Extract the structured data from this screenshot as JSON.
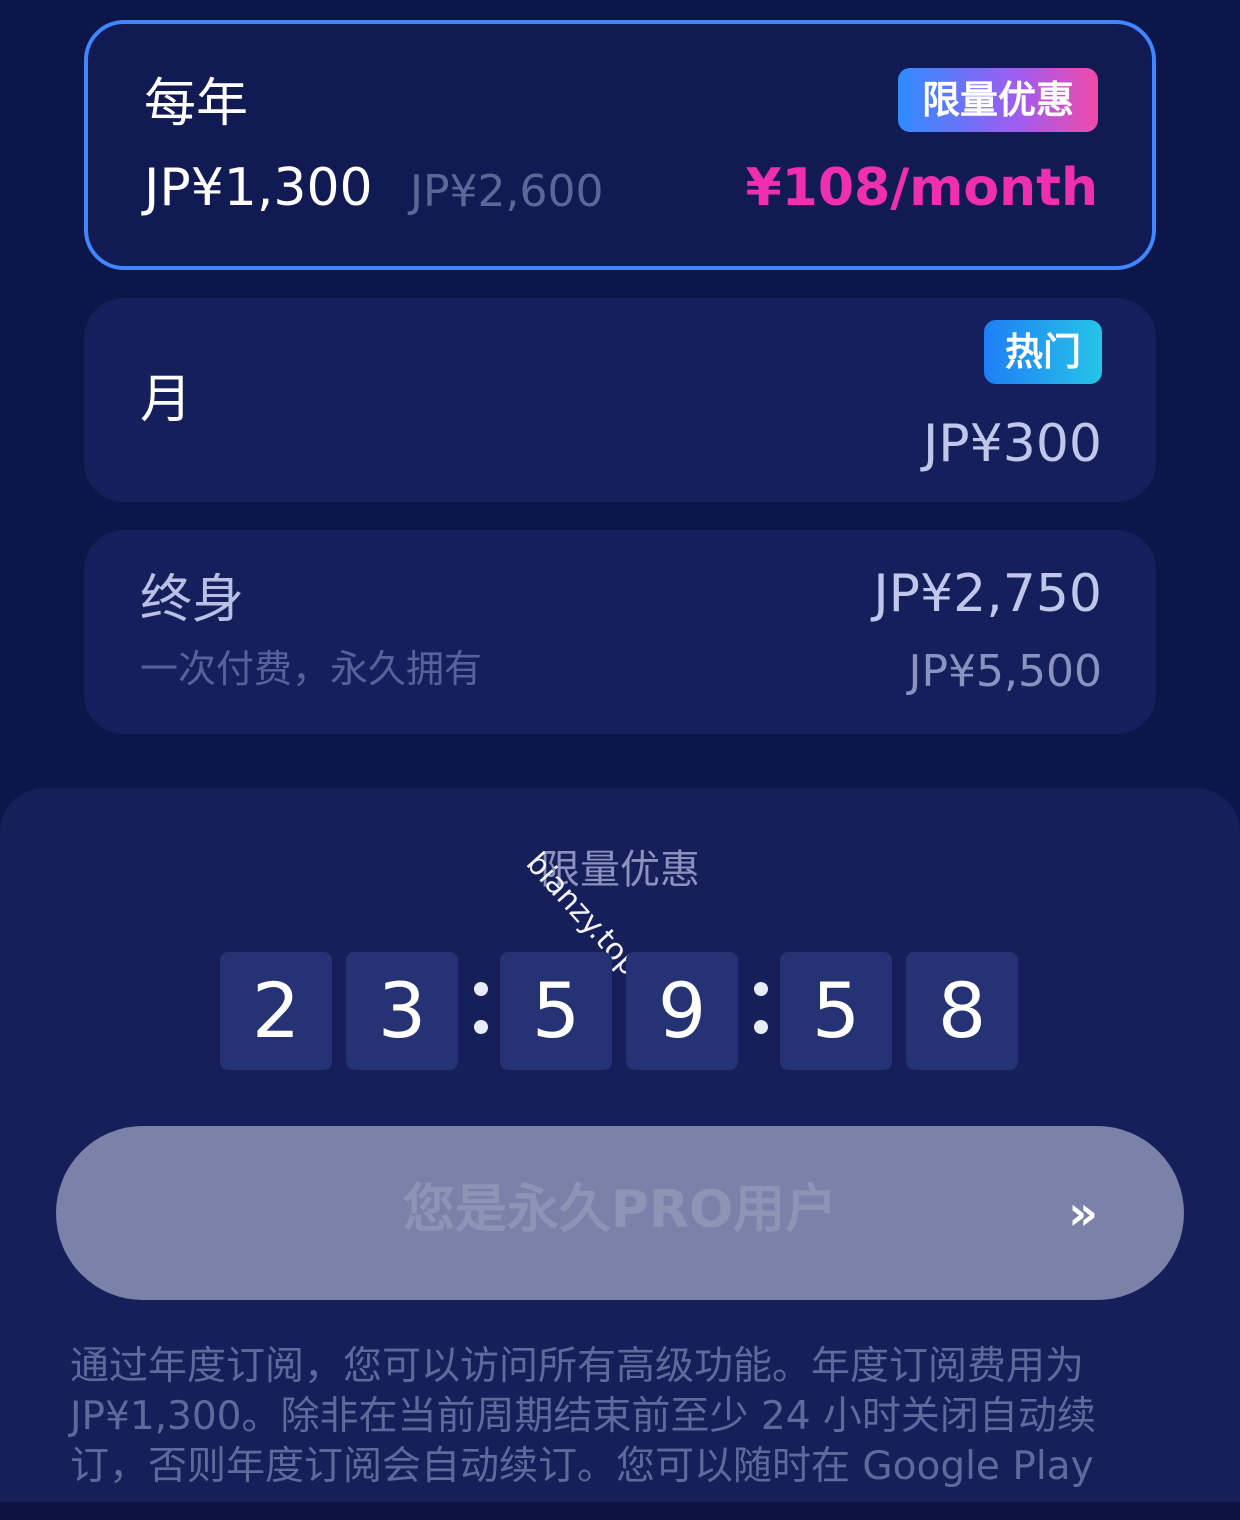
{
  "plans": {
    "yearly": {
      "name": "每年",
      "badge": "限量优惠",
      "price": "JP¥1,300",
      "original_price": "JP¥2,600",
      "per_month": "¥108/month"
    },
    "monthly": {
      "name": "月",
      "badge": "热门",
      "price": "JP¥300"
    },
    "lifetime": {
      "name": "终身",
      "subtitle": "一次付费，永久拥有",
      "price": "JP¥2,750",
      "original_price": "JP¥5,500"
    }
  },
  "offer": {
    "title": "限量优惠",
    "watermark": "bianzy.top",
    "countdown": {
      "h1": "2",
      "h2": "3",
      "m1": "5",
      "m2": "9",
      "s1": "5",
      "s2": "8"
    }
  },
  "cta": {
    "label": "您是永久PRO用户",
    "arrow": "»"
  },
  "terms": "通过年度订阅，您可以访问所有高级功能。年度订阅费用为 JP¥1,300。除非在当前周期结束前至少 24 小时关闭自动续订，否则年度订阅会自动续订。您可以随时在 Google Play",
  "colors": {
    "background": "#0d1648",
    "selected_border": "#3f86ff",
    "sale_price": "#f02fb0",
    "cta_disabled": "#7a82a9"
  }
}
